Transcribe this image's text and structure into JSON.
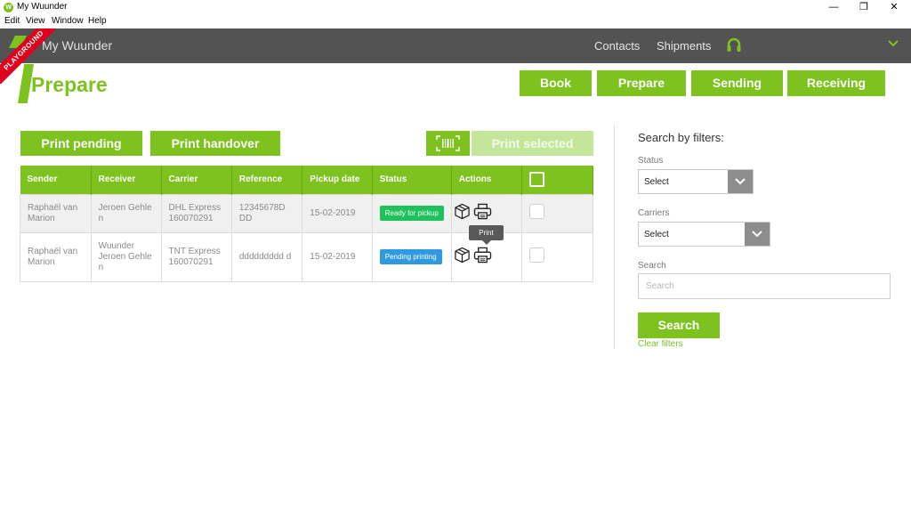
{
  "window": {
    "title": "My Wuunder",
    "app_icon_letter": "W",
    "controls": {
      "minimize": "—",
      "maximize": "❐",
      "close": "✕"
    }
  },
  "menubar": {
    "items": [
      "Edit",
      "View",
      "Window",
      "Help"
    ]
  },
  "appbar": {
    "brand": "My Wuunder",
    "ribbon": "PLAYGROUND",
    "nav": [
      "Contacts",
      "Shipments"
    ]
  },
  "page": {
    "title": "Prepare"
  },
  "tabs": [
    "Book",
    "Prepare",
    "Sending",
    "Receiving"
  ],
  "actions": {
    "print_pending": "Print pending",
    "print_handover": "Print handover",
    "print_selected": "Print selected"
  },
  "table": {
    "headers": [
      "Sender",
      "Receiver",
      "Carrier",
      "Reference",
      "Pickup date",
      "Status",
      "Actions"
    ],
    "rows": [
      {
        "sender": "Raphaël van Marion",
        "receiver": "Jeroen Gehle n",
        "carrier": "DHL Express 160070291",
        "reference": "12345678D DD",
        "pickup_date": "15-02-2019",
        "status": "Ready for pickup",
        "status_color": "#1ec25a"
      },
      {
        "sender": "Raphaël van Marion",
        "receiver": "Wuunder Jeroen Gehle n",
        "carrier": "TNT Express 160070291",
        "reference": "ddddddddd d",
        "pickup_date": "15-02-2019",
        "status": "Pending printing",
        "status_color": "#2f9ae0"
      }
    ]
  },
  "tooltip": {
    "text": "Print"
  },
  "filters": {
    "heading": "Search by filters:",
    "status_label": "Status",
    "status_value": "Select",
    "carriers_label": "Carriers",
    "carriers_value": "Select",
    "search_label": "Search",
    "search_placeholder": "Search",
    "search_button": "Search",
    "clear_link": "Clear filters"
  },
  "colors": {
    "accent": "#7dc21e",
    "header_bg": "#535353",
    "ribbon": "#e0001b"
  }
}
